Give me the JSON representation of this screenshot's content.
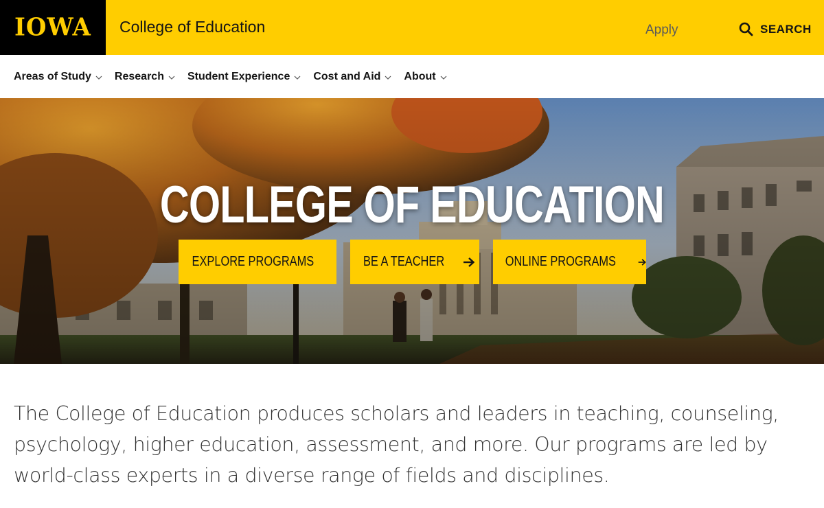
{
  "header": {
    "logo": "IOWA",
    "title": "College of Education",
    "apply_label": "Apply",
    "search_label": "SEARCH"
  },
  "nav": {
    "items": [
      {
        "label": "Areas of Study"
      },
      {
        "label": "Research"
      },
      {
        "label": "Student Experience"
      },
      {
        "label": "Cost and Aid"
      },
      {
        "label": "About"
      }
    ]
  },
  "hero": {
    "title": "COLLEGE OF EDUCATION",
    "buttons": [
      {
        "label": "EXPLORE PROGRAMS",
        "icon": "arrow-right-icon"
      },
      {
        "label": "BE A TEACHER",
        "icon": "arrow-right-icon"
      },
      {
        "label": "ONLINE PROGRAMS",
        "icon": "arrow-right-icon"
      }
    ]
  },
  "intro": {
    "text": "The College of Education produces scholars and leaders in teaching, counseling, psychology, higher education, assessment, and more. Our programs are led by world-class experts in a diverse range of fields and disciplines."
  },
  "colors": {
    "brand_gold": "#ffcd00",
    "brand_black": "#000000"
  }
}
